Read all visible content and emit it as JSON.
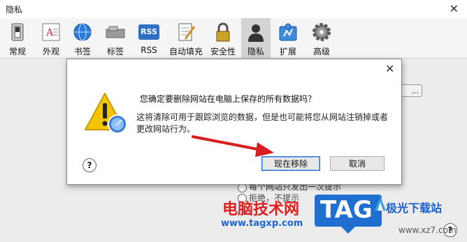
{
  "window": {
    "title": "隐私",
    "close_glyph": "✕"
  },
  "toolbar": {
    "items": [
      {
        "label": "常规",
        "icon": "switch-icon"
      },
      {
        "label": "外观",
        "icon": "font-icon"
      },
      {
        "label": "书签",
        "icon": "globe-icon"
      },
      {
        "label": "标签",
        "icon": "tabs-icon"
      },
      {
        "label": "RSS",
        "icon": "rss-icon",
        "badge": "RSS"
      },
      {
        "label": "自动填充",
        "icon": "form-pen-icon"
      },
      {
        "label": "安全性",
        "icon": "lock-icon"
      },
      {
        "label": "隐私",
        "icon": "person-silhouette-icon",
        "active": true
      },
      {
        "label": "扩展",
        "icon": "puzzle-icon"
      },
      {
        "label": "高级",
        "icon": "gear-icon"
      }
    ]
  },
  "background": {
    "details_button": "…",
    "radio1_label": "每个网站只发出一次提示",
    "radio2_label": "拒绝，不提示",
    "help_glyph": "?"
  },
  "dialog": {
    "close_glyph": "✕",
    "title": "您确定要删除网站在电脑上保存的所有数据吗？",
    "message": "这将清除可用于跟踪浏览的数据，但是也可能将您从网站注销掉或者更改网站行为。",
    "help_glyph": "?",
    "confirm_label": "现在移除",
    "cancel_label": "取消"
  },
  "watermark": {
    "brand_cn": "电脑技术网",
    "brand_url": "www.tagxp.com",
    "tag_logo": "TAG",
    "site_cn": "极光下载站",
    "site_url": "www.xz7.com"
  },
  "colors": {
    "accent_blue": "#2a72d0",
    "warning_yellow": "#f5c400",
    "arrow_red": "#d81e1e"
  }
}
